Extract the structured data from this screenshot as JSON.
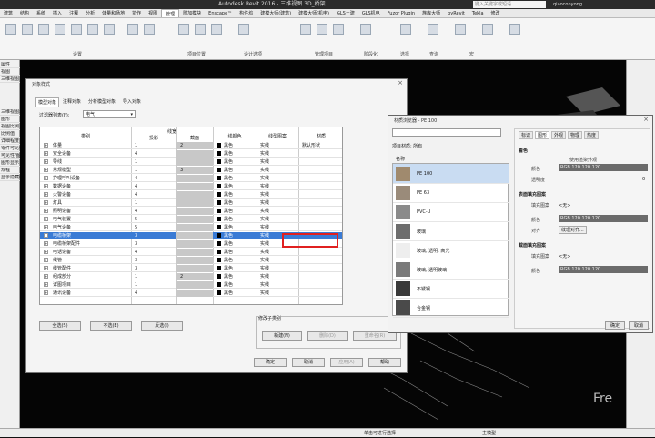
{
  "app": {
    "title": "Autodesk Revit 2016 -    三维视图 3D_桥架",
    "search_placeholder": "键入关键字或短语",
    "user": "qiaoconyong..."
  },
  "ribbon_tabs": [
    "建筑",
    "结构",
    "系统",
    "插入",
    "注释",
    "分析",
    "体量和场地",
    "协作",
    "视图",
    "管理",
    "附加模块",
    "Enscape™",
    "构件坞",
    "建模大师(建筑)",
    "建模大师(机电)",
    "GLS土建",
    "GLS机电",
    "Fuzor Plugin",
    "族库大师",
    "pyRevit",
    "Tekla",
    "修改"
  ],
  "ribbon_groups": [
    "设置",
    "项目位置",
    "设计选项",
    "管理项目",
    "阶段化",
    "选择",
    "查询",
    "宏"
  ],
  "left_panel": {
    "items": [
      "属性",
      "视图",
      "三维视图",
      "三维视图: 3D",
      "图形",
      "视图比例",
      "比例值",
      "详细程度",
      "零件可见性",
      "可见性/图形",
      "图形显示",
      "规程",
      "显示隐藏线"
    ]
  },
  "status_bar": {
    "left": "单击可进行选择",
    "mid": "主模型"
  },
  "object_styles": {
    "title": "对象样式",
    "tabs": [
      "模型对象",
      "注释对象",
      "分析模型对象",
      "导入对象"
    ],
    "filter_label": "过滤器列表(F):",
    "filter_value": "电气",
    "columns": {
      "category": "类别",
      "lineweight": "线宽",
      "projection": "投影",
      "cut": "截面",
      "line_color": "线颜色",
      "line_pattern": "线型图案",
      "material": "材质"
    },
    "rows": [
      {
        "name": "体量",
        "proj": "1",
        "cut": "2",
        "color": "黑色",
        "pattern": "实线",
        "material": "默认形状"
      },
      {
        "name": "安全设备",
        "proj": "4",
        "cut": "",
        "color": "黑色",
        "pattern": "实线",
        "material": ""
      },
      {
        "name": "导线",
        "proj": "1",
        "cut": "",
        "color": "黑色",
        "pattern": "实线",
        "material": ""
      },
      {
        "name": "常规模型",
        "proj": "1",
        "cut": "3",
        "color": "黑色",
        "pattern": "实线",
        "material": ""
      },
      {
        "name": "护理呼叫设备",
        "proj": "4",
        "cut": "",
        "color": "黑色",
        "pattern": "实线",
        "material": ""
      },
      {
        "name": "数据设备",
        "proj": "4",
        "cut": "",
        "color": "黑色",
        "pattern": "实线",
        "material": ""
      },
      {
        "name": "火警设备",
        "proj": "4",
        "cut": "",
        "color": "黑色",
        "pattern": "实线",
        "material": ""
      },
      {
        "name": "灯具",
        "proj": "1",
        "cut": "",
        "color": "黑色",
        "pattern": "实线",
        "material": ""
      },
      {
        "name": "照明设备",
        "proj": "4",
        "cut": "",
        "color": "黑色",
        "pattern": "实线",
        "material": ""
      },
      {
        "name": "电气装置",
        "proj": "5",
        "cut": "",
        "color": "黑色",
        "pattern": "实线",
        "material": ""
      },
      {
        "name": "电气设备",
        "proj": "5",
        "cut": "",
        "color": "黑色",
        "pattern": "实线",
        "material": ""
      },
      {
        "name": "电缆桥架",
        "proj": "3",
        "cut": "",
        "color": "黑色",
        "pattern": "实线",
        "material": "",
        "selected": true
      },
      {
        "name": "电缆桥架配件",
        "proj": "3",
        "cut": "",
        "color": "黑色",
        "pattern": "实线",
        "material": ""
      },
      {
        "name": "电话设备",
        "proj": "4",
        "cut": "",
        "color": "黑色",
        "pattern": "实线",
        "material": ""
      },
      {
        "name": "线管",
        "proj": "3",
        "cut": "",
        "color": "黑色",
        "pattern": "实线",
        "material": ""
      },
      {
        "name": "线管配件",
        "proj": "3",
        "cut": "",
        "color": "黑色",
        "pattern": "实线",
        "material": ""
      },
      {
        "name": "组成部分",
        "proj": "1",
        "cut": "2",
        "color": "黑色",
        "pattern": "实线",
        "material": ""
      },
      {
        "name": "详图项目",
        "proj": "1",
        "cut": "",
        "color": "黑色",
        "pattern": "实线",
        "material": ""
      },
      {
        "name": "通讯设备",
        "proj": "4",
        "cut": "",
        "color": "黑色",
        "pattern": "实线",
        "material": ""
      }
    ],
    "buttons": {
      "select_all": "全选(S)",
      "select_none": "不选(E)",
      "invert": "反选(I)",
      "ok": "确定",
      "cancel": "取消",
      "apply": "应用(A)",
      "help": "帮助"
    },
    "subcat": {
      "label": "修改子类别",
      "new": "新建(N)",
      "delete": "删除(D)",
      "rename": "重命名(R)"
    }
  },
  "material_browser": {
    "title": "材质浏览器 - PE 100",
    "project_materials": "项目材质: 所有",
    "list_header": "名称",
    "materials": [
      {
        "name": "PE 100",
        "selected": true,
        "thumb": "#a08a6e"
      },
      {
        "name": "PE 63",
        "selected": false,
        "thumb": "#9a8b7a"
      },
      {
        "name": "PVC-U",
        "selected": false,
        "thumb": "#8a8a8a"
      },
      {
        "name": "玻璃",
        "selected": false,
        "thumb": "#6d6d6d"
      },
      {
        "name": "玻璃, 透明, 高光",
        "selected": false,
        "thumb": "#eeeeee"
      },
      {
        "name": "玻璃, 透明玻璃",
        "selected": false,
        "thumb": "#7a7a7a"
      },
      {
        "name": "不锈钢",
        "selected": false,
        "thumb": "#3a3a3a"
      },
      {
        "name": "合金钢",
        "selected": false,
        "thumb": "#4a4a4a"
      }
    ],
    "tabs": [
      "标识",
      "图形",
      "外观",
      "物理",
      "热度"
    ],
    "sections": {
      "shading": "着色",
      "surface": "表面填充图案",
      "cut": "截面填充图案"
    },
    "props": {
      "color": "颜色",
      "use_render": "使用渲染外观",
      "transparency": "透明度",
      "fill_pattern": "填充图案",
      "align": "对齐",
      "rgb": "RGB 120 120 120",
      "none": "<无>",
      "texture_align": "纹理对齐...",
      "trans_value": "0"
    },
    "buttons": {
      "ok": "确定",
      "cancel": "取消"
    }
  },
  "watermark": "Fre"
}
